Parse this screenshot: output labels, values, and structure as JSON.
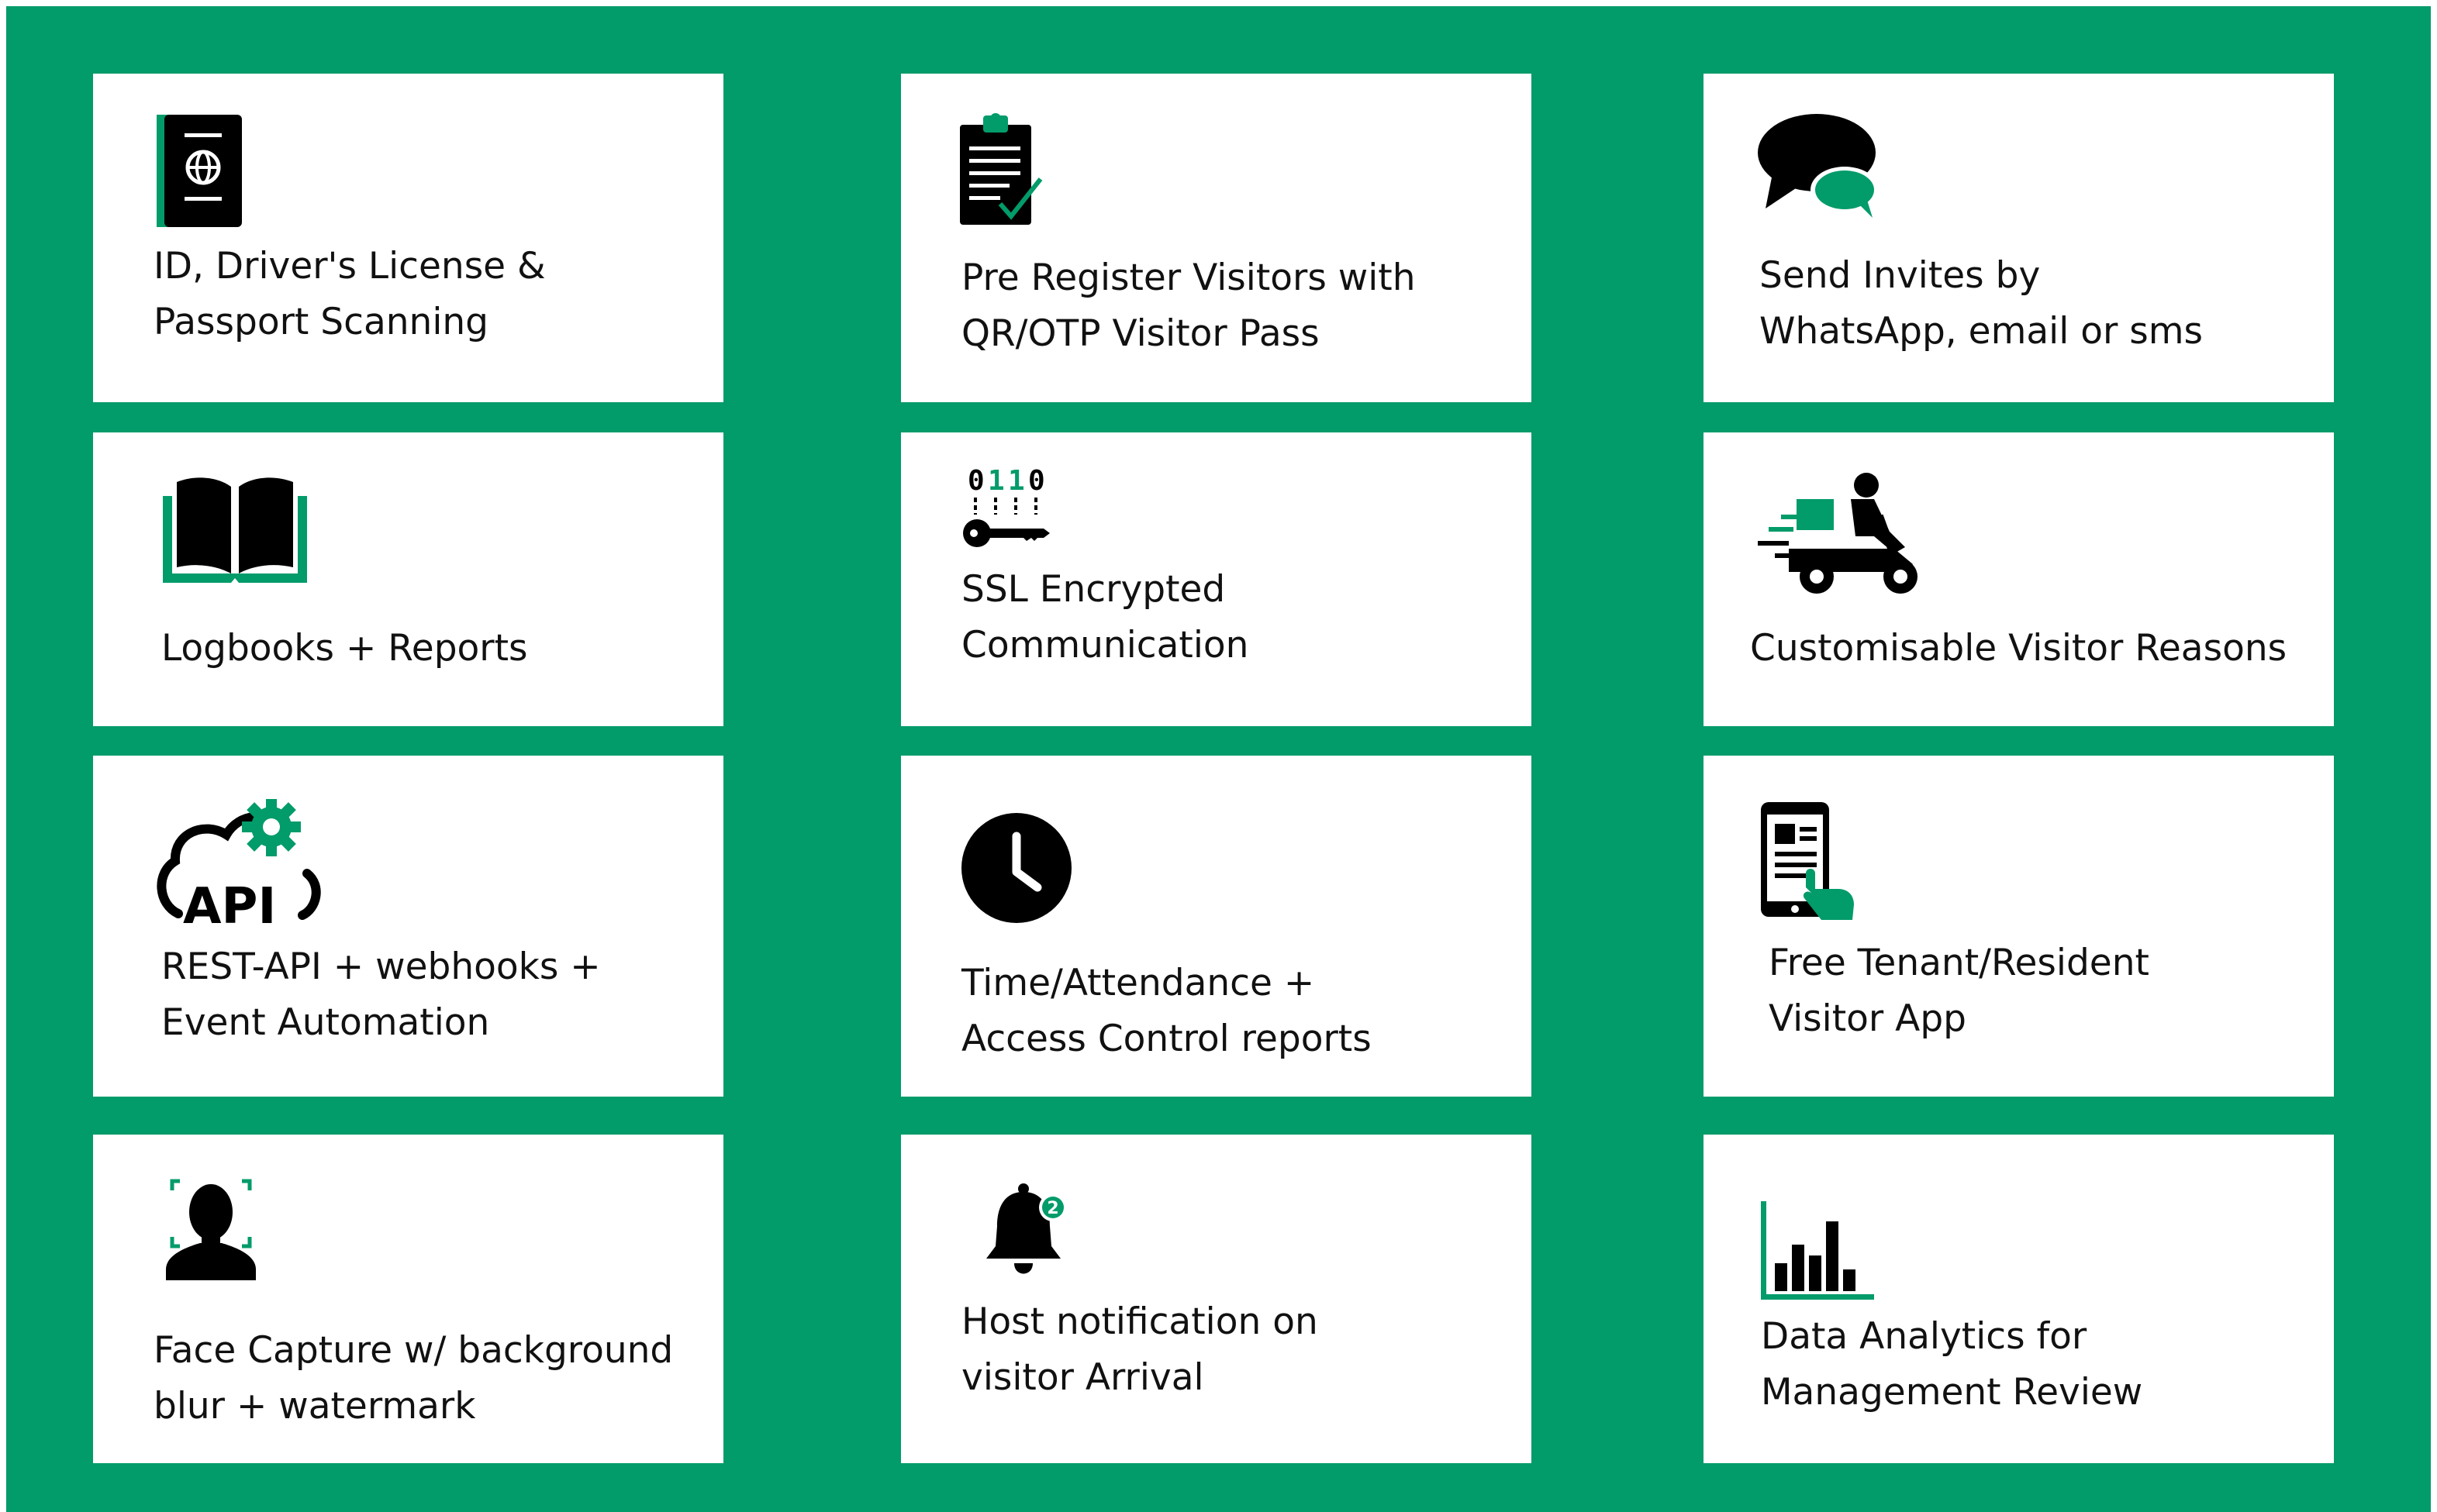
{
  "colors": {
    "background": "#029b6a",
    "card": "#ffffff",
    "icon_dark": "#000000",
    "icon_accent": "#029b6a",
    "text": "#111111"
  },
  "features": [
    {
      "icon": "passport-icon",
      "lines": [
        "ID, Driver's License &",
        "Passport Scanning"
      ]
    },
    {
      "icon": "clipboard-check-icon",
      "lines": [
        "Pre Register Visitors with",
        "QR/OTP Visitor Pass"
      ]
    },
    {
      "icon": "chat-bubbles-icon",
      "lines": [
        "Send Invites by",
        "WhatsApp, email or sms"
      ]
    },
    {
      "icon": "open-book-icon",
      "lines": [
        "Logbooks + Reports"
      ]
    },
    {
      "icon": "encrypted-key-icon",
      "lines": [
        "SSL Encrypted",
        "Communication"
      ],
      "binary": [
        "0",
        "1",
        "1",
        "0"
      ]
    },
    {
      "icon": "scooter-rider-icon",
      "lines": [
        "Customisable Visitor Reasons"
      ]
    },
    {
      "icon": "api-cloud-gear-icon",
      "lines": [
        "REST-API + webhooks +",
        "Event Automation"
      ],
      "icon_text": "API"
    },
    {
      "icon": "clock-icon",
      "lines": [
        "Time/Attendance +",
        "Access Control reports"
      ]
    },
    {
      "icon": "phone-tap-icon",
      "lines": [
        "Free Tenant/Resident",
        "Visitor App"
      ]
    },
    {
      "icon": "face-capture-icon",
      "lines": [
        "Face Capture w/ background",
        "blur + watermark"
      ]
    },
    {
      "icon": "bell-notification-icon",
      "lines": [
        "Host notification on",
        "visitor Arrival"
      ],
      "badge": "2"
    },
    {
      "icon": "bar-chart-icon",
      "lines": [
        "Data Analytics for",
        "Management Review"
      ]
    }
  ]
}
